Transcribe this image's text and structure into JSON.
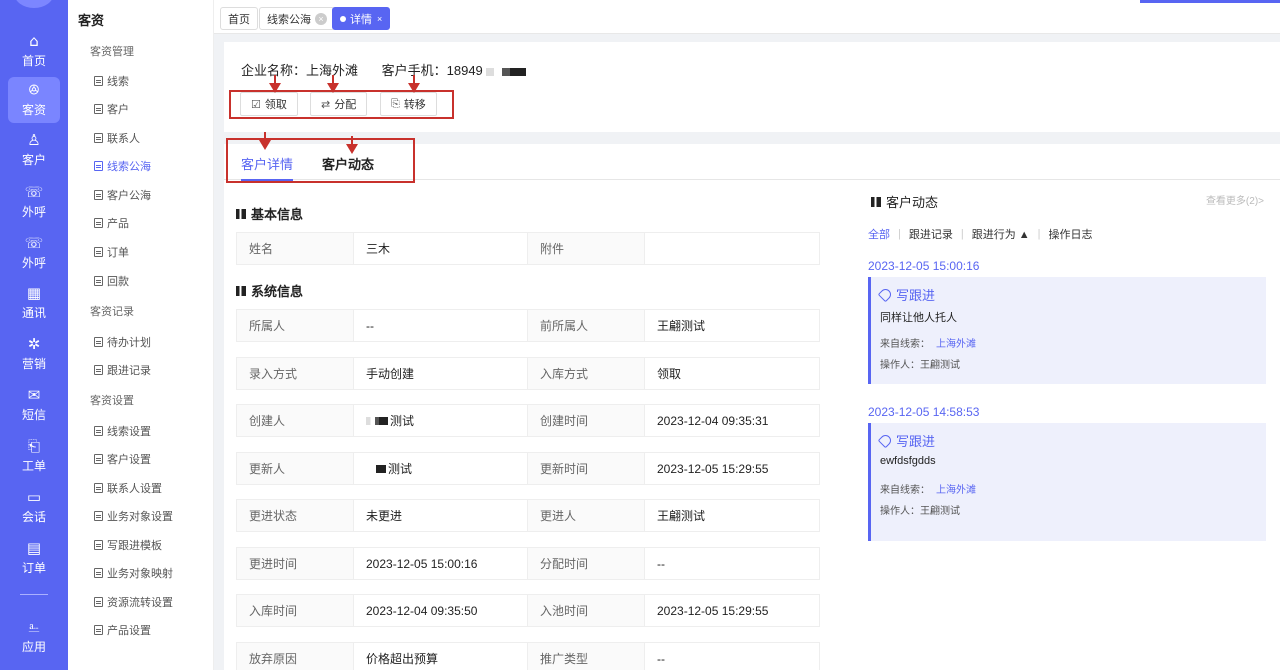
{
  "rail": {
    "items": [
      {
        "icon": "⌂",
        "label": "首页"
      },
      {
        "icon": "ꔮ",
        "label": "客资"
      },
      {
        "icon": "♙",
        "label": "客户"
      },
      {
        "icon": "☏",
        "label": "外呼"
      },
      {
        "icon": "☏",
        "label": "外呼"
      },
      {
        "icon": "▦",
        "label": "通讯"
      },
      {
        "icon": "✲",
        "label": "营销"
      },
      {
        "icon": "✉",
        "label": "短信"
      },
      {
        "icon": "⎗",
        "label": "工单"
      },
      {
        "icon": "▭",
        "label": "会话"
      },
      {
        "icon": "▤",
        "label": "订单"
      },
      {
        "icon": "⎁",
        "label": "应用"
      }
    ]
  },
  "sidebar": {
    "title": "客资",
    "groups": [
      {
        "label": "客资管理",
        "items": [
          "线索",
          "客户",
          "联系人",
          "线索公海",
          "客户公海",
          "产品",
          "订单",
          "回款"
        ]
      },
      {
        "label": "客资记录",
        "items": [
          "待办计划",
          "跟进记录"
        ]
      },
      {
        "label": "客资设置",
        "items": [
          "线索设置",
          "客户设置",
          "联系人设置",
          "业务对象设置",
          "写跟进模板",
          "业务对象映射",
          "资源流转设置",
          "产品设置"
        ]
      }
    ],
    "active_item": "线索公海"
  },
  "tabs": {
    "home": "首页",
    "leads_pool": "线索公海",
    "detail": "详情"
  },
  "header": {
    "company_label": "企业名称：上海外滩",
    "phone_label": "客户手机：18949"
  },
  "actions": {
    "claim": "领取",
    "assign": "分配",
    "transfer": "转移"
  },
  "detail_tabs": {
    "detail": "客户详情",
    "activity": "客户动态"
  },
  "basic_info": {
    "title": "基本信息",
    "rows": [
      {
        "k1": "姓名",
        "v1": "三木",
        "k2": "附件",
        "v2": ""
      }
    ]
  },
  "system_info": {
    "title": "系统信息",
    "rows": [
      {
        "k1": "所属人",
        "v1": "--",
        "k2": "前所属人",
        "v2": "王翩测试"
      },
      {
        "k1": "录入方式",
        "v1": "手动创建",
        "k2": "入库方式",
        "v2": "领取"
      },
      {
        "k1": "创建人",
        "v1": "测试",
        "k2": "创建时间",
        "v2": "2023-12-04 09:35:31"
      },
      {
        "k1": "更新人",
        "v1": "测试",
        "k2": "更新时间",
        "v2": "2023-12-05 15:29:55"
      },
      {
        "k1": "更进状态",
        "v1": "未更进",
        "k2": "更进人",
        "v2": "王翩测试"
      },
      {
        "k1": "更进时间",
        "v1": "2023-12-05 15:00:16",
        "k2": "分配时间",
        "v2": "--"
      },
      {
        "k1": "入库时间",
        "v1": "2023-12-04 09:35:50",
        "k2": "入池时间",
        "v2": "2023-12-05 15:29:55"
      },
      {
        "k1": "放弃原因",
        "v1": "价格超出预算",
        "k2": "推广类型",
        "v2": "--"
      }
    ]
  },
  "activity_panel": {
    "title": "客户动态",
    "more": "查看更多(2)>",
    "filters": [
      "全部",
      "跟进记录",
      "跟进行为 ▲",
      "操作日志"
    ],
    "entries": [
      {
        "date": "2023-12-05 15:00:16",
        "type": "写跟进",
        "body": "同样让他人托人",
        "source_label": "来自线索：",
        "source_link": "上海外滩",
        "operator": "操作人：王翩测试"
      },
      {
        "date": "2023-12-05 14:58:53",
        "type": "写跟进",
        "body": "ewfdsfgdds",
        "source_label": "来自线索：",
        "source_link": "上海外滩",
        "operator": "操作人：王翩测试"
      }
    ]
  },
  "colors": {
    "accent": "#5865f2",
    "annotation": "#c8312c"
  }
}
